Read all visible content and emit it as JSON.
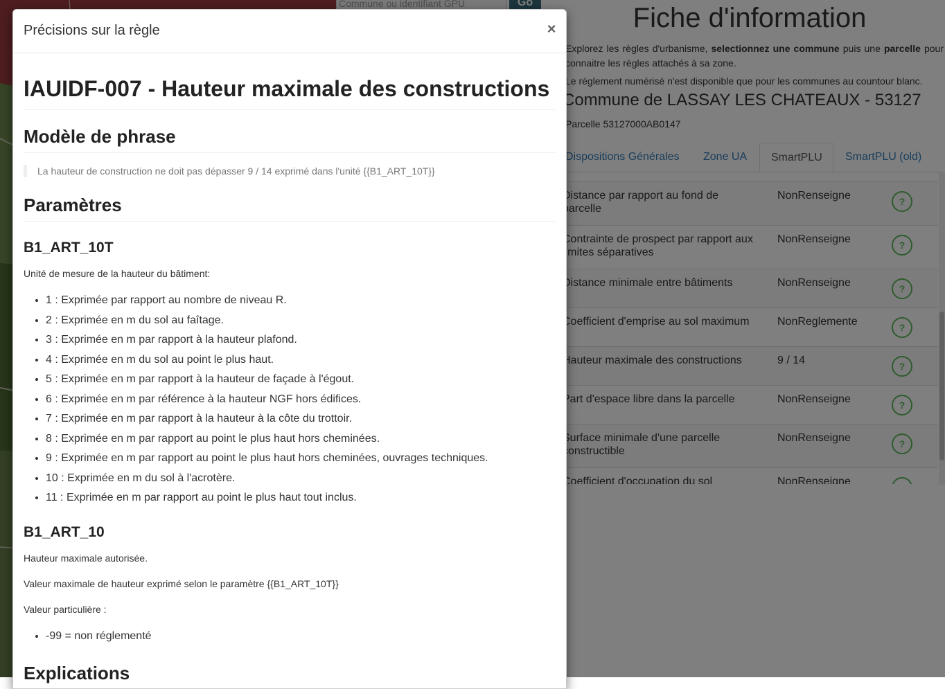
{
  "map": {
    "search_placeholder": "Commune ou identifiant GPU",
    "search_button": "Go"
  },
  "info_panel": {
    "title": "Fiche d'information",
    "intro_1_a": "Explorez les règles d'urbanisme, ",
    "intro_1_b": "selectionnez une commune",
    "intro_1_c": " puis une ",
    "intro_1_d": "parcelle",
    "intro_1_e": " pour connaitre les règles attachés à sa zone.",
    "intro_2": "Le réglement numérisé n'est disponible que pour les communes au countour blanc.",
    "commune_title": "Commune de LASSAY LES CHATEAUX - 53127",
    "parcelle": "Parcelle 53127000AB0147",
    "tabs": [
      {
        "label": "Dispositions Générales"
      },
      {
        "label": "Zone UA"
      },
      {
        "label": "SmartPLU"
      },
      {
        "label": "SmartPLU (old)"
      }
    ],
    "rules": [
      {
        "name": "Distance par rapport au fond de parcelle",
        "value": "NonRenseigne"
      },
      {
        "name": "Contrainte de prospect par rapport aux limites séparatives",
        "value": "NonRenseigne"
      },
      {
        "name": "Distance minimale entre bâtiments",
        "value": "NonRenseigne"
      },
      {
        "name": "Coefficient d'emprise au sol maximum",
        "value": "NonReglemente"
      },
      {
        "name": "Hauteur maximale des constructions",
        "value": "9 / 14"
      },
      {
        "name": "Part d'espace libre dans la parcelle",
        "value": "NonRenseigne"
      },
      {
        "name": "Surface minimale d'une parcelle constructible",
        "value": "NonRenseigne"
      },
      {
        "name": "Coefficient d'occupation du sol",
        "value": "NonRenseigne"
      }
    ],
    "help_label": "?"
  },
  "modal": {
    "title": "Précisions sur la règle",
    "close_symbol": "×",
    "rule_heading": "IAUIDF-007 - Hauteur maximale des constructions",
    "model_heading": "Modèle de phrase",
    "model_sentence": "La hauteur de construction ne doit pas dépasser 9 / 14 exprimé dans l'unité {{B1_ART_10T}}",
    "params_heading": "Paramètres",
    "param_1": {
      "name": "B1_ART_10T",
      "description": "Unité de mesure de la hauteur du bâtiment:",
      "options": [
        "1 : Exprimée par rapport au nombre de niveau R.",
        "2 : Exprimée en m du sol au faîtage.",
        "3 : Exprimée en m par rapport à la hauteur plafond.",
        "4 : Exprimée en m du sol au point le plus haut.",
        "5 : Exprimée en m par rapport à la hauteur de façade à l'égout.",
        "6 : Exprimée en m par référence à la hauteur NGF hors édifices.",
        "7 : Exprimée en m par rapport à la hauteur à la côte du trottoir.",
        "8 : Exprimée en m par rapport au point le plus haut hors cheminées.",
        "9 : Exprimée en m par rapport au point le plus haut hors cheminées, ouvrages techniques.",
        "10 : Exprimée en m du sol à l'acrotère.",
        "11 : Exprimée en m par rapport au point le plus haut tout inclus."
      ]
    },
    "param_2": {
      "name": "B1_ART_10",
      "description_1": "Hauteur maximale autorisée.",
      "description_2": "Valeur maximale de hauteur exprimé selon le paramètre {{B1_ART_10T}}",
      "description_3": "Valeur particulière :",
      "options": [
        "-99 = non réglementé"
      ]
    },
    "explanations_heading": "Explications"
  }
}
